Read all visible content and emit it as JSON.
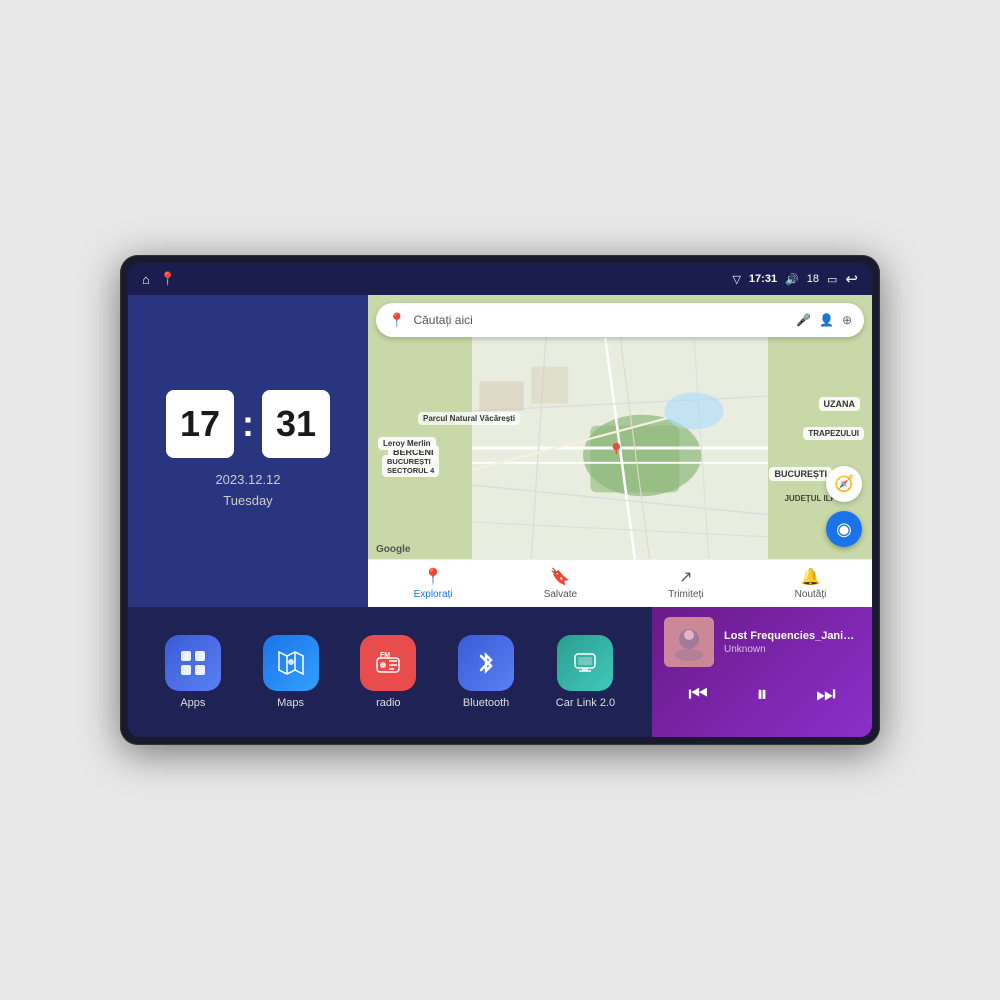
{
  "device": {
    "status_bar": {
      "signal_icon": "▽",
      "time": "17:31",
      "volume_icon": "🔊",
      "battery_level": "18",
      "battery_icon": "🔋",
      "back_icon": "↩"
    },
    "clock": {
      "hours": "17",
      "minutes": "31",
      "date": "2023.12.12",
      "day": "Tuesday"
    },
    "map": {
      "search_placeholder": "Căutați aici",
      "nav_items": [
        {
          "label": "Explorați",
          "icon": "📍",
          "active": true
        },
        {
          "label": "Salvate",
          "icon": "🔖",
          "active": false
        },
        {
          "label": "Trimiteți",
          "icon": "↗",
          "active": false
        },
        {
          "label": "Noutăți",
          "icon": "🔔",
          "active": false
        }
      ],
      "labels": {
        "uzana": "UZANA",
        "trapezului": "TRAPEZULUI",
        "bucuresti": "BUCUREȘTI",
        "ilfov": "JUDEȚUL ILFOV",
        "berceni": "BERCENI",
        "leroy": "Leroy Merlin",
        "parcul": "Parcul Natural Văcărești",
        "sector4": "BUCUREȘTI\nSECTORUL 4"
      }
    },
    "apps": [
      {
        "id": "apps",
        "label": "Apps",
        "icon": "⊞",
        "bg": "apps-bg"
      },
      {
        "id": "maps",
        "label": "Maps",
        "icon": "🗺",
        "bg": "maps-bg"
      },
      {
        "id": "radio",
        "label": "radio",
        "icon": "📻",
        "bg": "radio-bg"
      },
      {
        "id": "bluetooth",
        "label": "Bluetooth",
        "icon": "🔷",
        "bg": "bt-bg"
      },
      {
        "id": "carlink",
        "label": "Car Link 2.0",
        "icon": "📱",
        "bg": "carlink-bg"
      }
    ],
    "music": {
      "title": "Lost Frequencies_Janieck Devy-...",
      "artist": "Unknown",
      "prev_icon": "⏮",
      "play_icon": "⏸",
      "next_icon": "⏭"
    }
  }
}
